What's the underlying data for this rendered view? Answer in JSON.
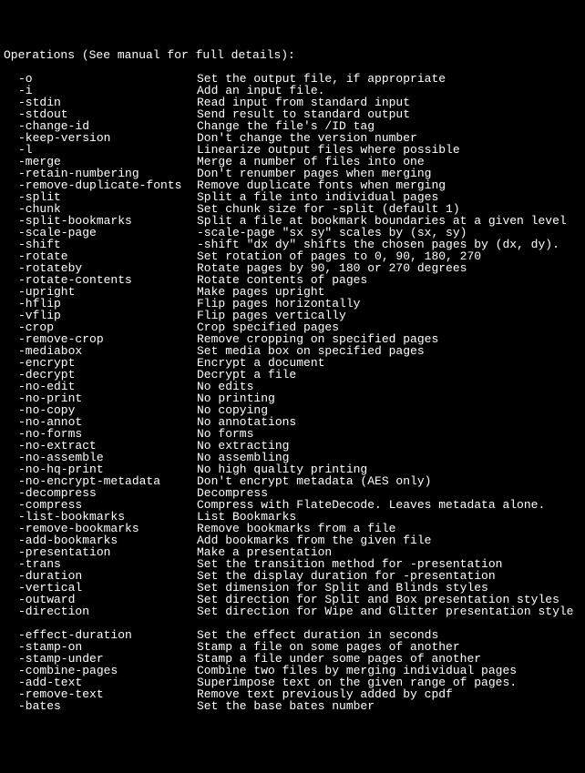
{
  "header": "Operations (See manual for full details):",
  "options": [
    {
      "flag": "-o",
      "desc": "Set the output file, if appropriate"
    },
    {
      "flag": "-i",
      "desc": "Add an input file."
    },
    {
      "flag": "-stdin",
      "desc": "Read input from standard input"
    },
    {
      "flag": "-stdout",
      "desc": "Send result to standard output"
    },
    {
      "flag": "-change-id",
      "desc": "Change the file's /ID tag"
    },
    {
      "flag": "-keep-version",
      "desc": "Don't change the version number"
    },
    {
      "flag": "-l",
      "desc": "Linearize output files where possible"
    },
    {
      "flag": "-merge",
      "desc": "Merge a number of files into one"
    },
    {
      "flag": "-retain-numbering",
      "desc": "Don't renumber pages when merging"
    },
    {
      "flag": "-remove-duplicate-fonts",
      "desc": "Remove duplicate fonts when merging"
    },
    {
      "flag": "-split",
      "desc": "Split a file into individual pages"
    },
    {
      "flag": "-chunk",
      "desc": "Set chunk size for -split (default 1)"
    },
    {
      "flag": "-split-bookmarks",
      "desc": "Split a file at bookmark boundaries at a given level"
    },
    {
      "flag": "-scale-page",
      "desc": "-scale-page \"sx sy\" scales by (sx, sy)"
    },
    {
      "flag": "-shift",
      "desc": "-shift \"dx dy\" shifts the chosen pages by (dx, dy)."
    },
    {
      "flag": "-rotate",
      "desc": "Set rotation of pages to 0, 90, 180, 270"
    },
    {
      "flag": "-rotateby",
      "desc": "Rotate pages by 90, 180 or 270 degrees"
    },
    {
      "flag": "-rotate-contents",
      "desc": "Rotate contents of pages"
    },
    {
      "flag": "-upright",
      "desc": "Make pages upright"
    },
    {
      "flag": "-hflip",
      "desc": "Flip pages horizontally"
    },
    {
      "flag": "-vflip",
      "desc": "Flip pages vertically"
    },
    {
      "flag": "-crop",
      "desc": "Crop specified pages"
    },
    {
      "flag": "-remove-crop",
      "desc": "Remove cropping on specified pages"
    },
    {
      "flag": "-mediabox",
      "desc": "Set media box on specified pages"
    },
    {
      "flag": "-encrypt",
      "desc": "Encrypt a document"
    },
    {
      "flag": "-decrypt",
      "desc": "Decrypt a file"
    },
    {
      "flag": "-no-edit",
      "desc": "No edits"
    },
    {
      "flag": "-no-print",
      "desc": "No printing"
    },
    {
      "flag": "-no-copy",
      "desc": "No copying"
    },
    {
      "flag": "-no-annot",
      "desc": "No annotations"
    },
    {
      "flag": "-no-forms",
      "desc": "No forms"
    },
    {
      "flag": "-no-extract",
      "desc": "No extracting"
    },
    {
      "flag": "-no-assemble",
      "desc": "No assembling"
    },
    {
      "flag": "-no-hq-print",
      "desc": "No high quality printing"
    },
    {
      "flag": "-no-encrypt-metadata",
      "desc": "Don't encrypt metadata (AES only)"
    },
    {
      "flag": "-decompress",
      "desc": "Decompress"
    },
    {
      "flag": "-compress",
      "desc": "Compress with FlateDecode. Leaves metadata alone."
    },
    {
      "flag": "-list-bookmarks",
      "desc": "List Bookmarks"
    },
    {
      "flag": "-remove-bookmarks",
      "desc": "Remove bookmarks from a file"
    },
    {
      "flag": "-add-bookmarks",
      "desc": "Add bookmarks from the given file"
    },
    {
      "flag": "-presentation",
      "desc": "Make a presentation"
    },
    {
      "flag": "-trans",
      "desc": "Set the transition method for -presentation"
    },
    {
      "flag": "-duration",
      "desc": "Set the display duration for -presentation"
    },
    {
      "flag": "-vertical",
      "desc": "Set dimension for Split and Blinds styles"
    },
    {
      "flag": "-outward",
      "desc": "Set direction for Split and Box presentation styles"
    },
    {
      "flag": "-direction",
      "desc": "Set direction for Wipe and Glitter presentation style"
    },
    {
      "type": "blank"
    },
    {
      "flag": "-effect-duration",
      "desc": "Set the effect duration in seconds"
    },
    {
      "flag": "-stamp-on",
      "desc": "Stamp a file on some pages of another"
    },
    {
      "flag": "-stamp-under",
      "desc": "Stamp a file under some pages of another"
    },
    {
      "flag": "-combine-pages",
      "desc": "Combine two files by merging individual pages"
    },
    {
      "flag": "-add-text",
      "desc": "Superimpose text on the given range of pages."
    },
    {
      "flag": "-remove-text",
      "desc": "Remove text previously added by cpdf"
    },
    {
      "flag": "-bates",
      "desc": "Set the base bates number"
    }
  ]
}
